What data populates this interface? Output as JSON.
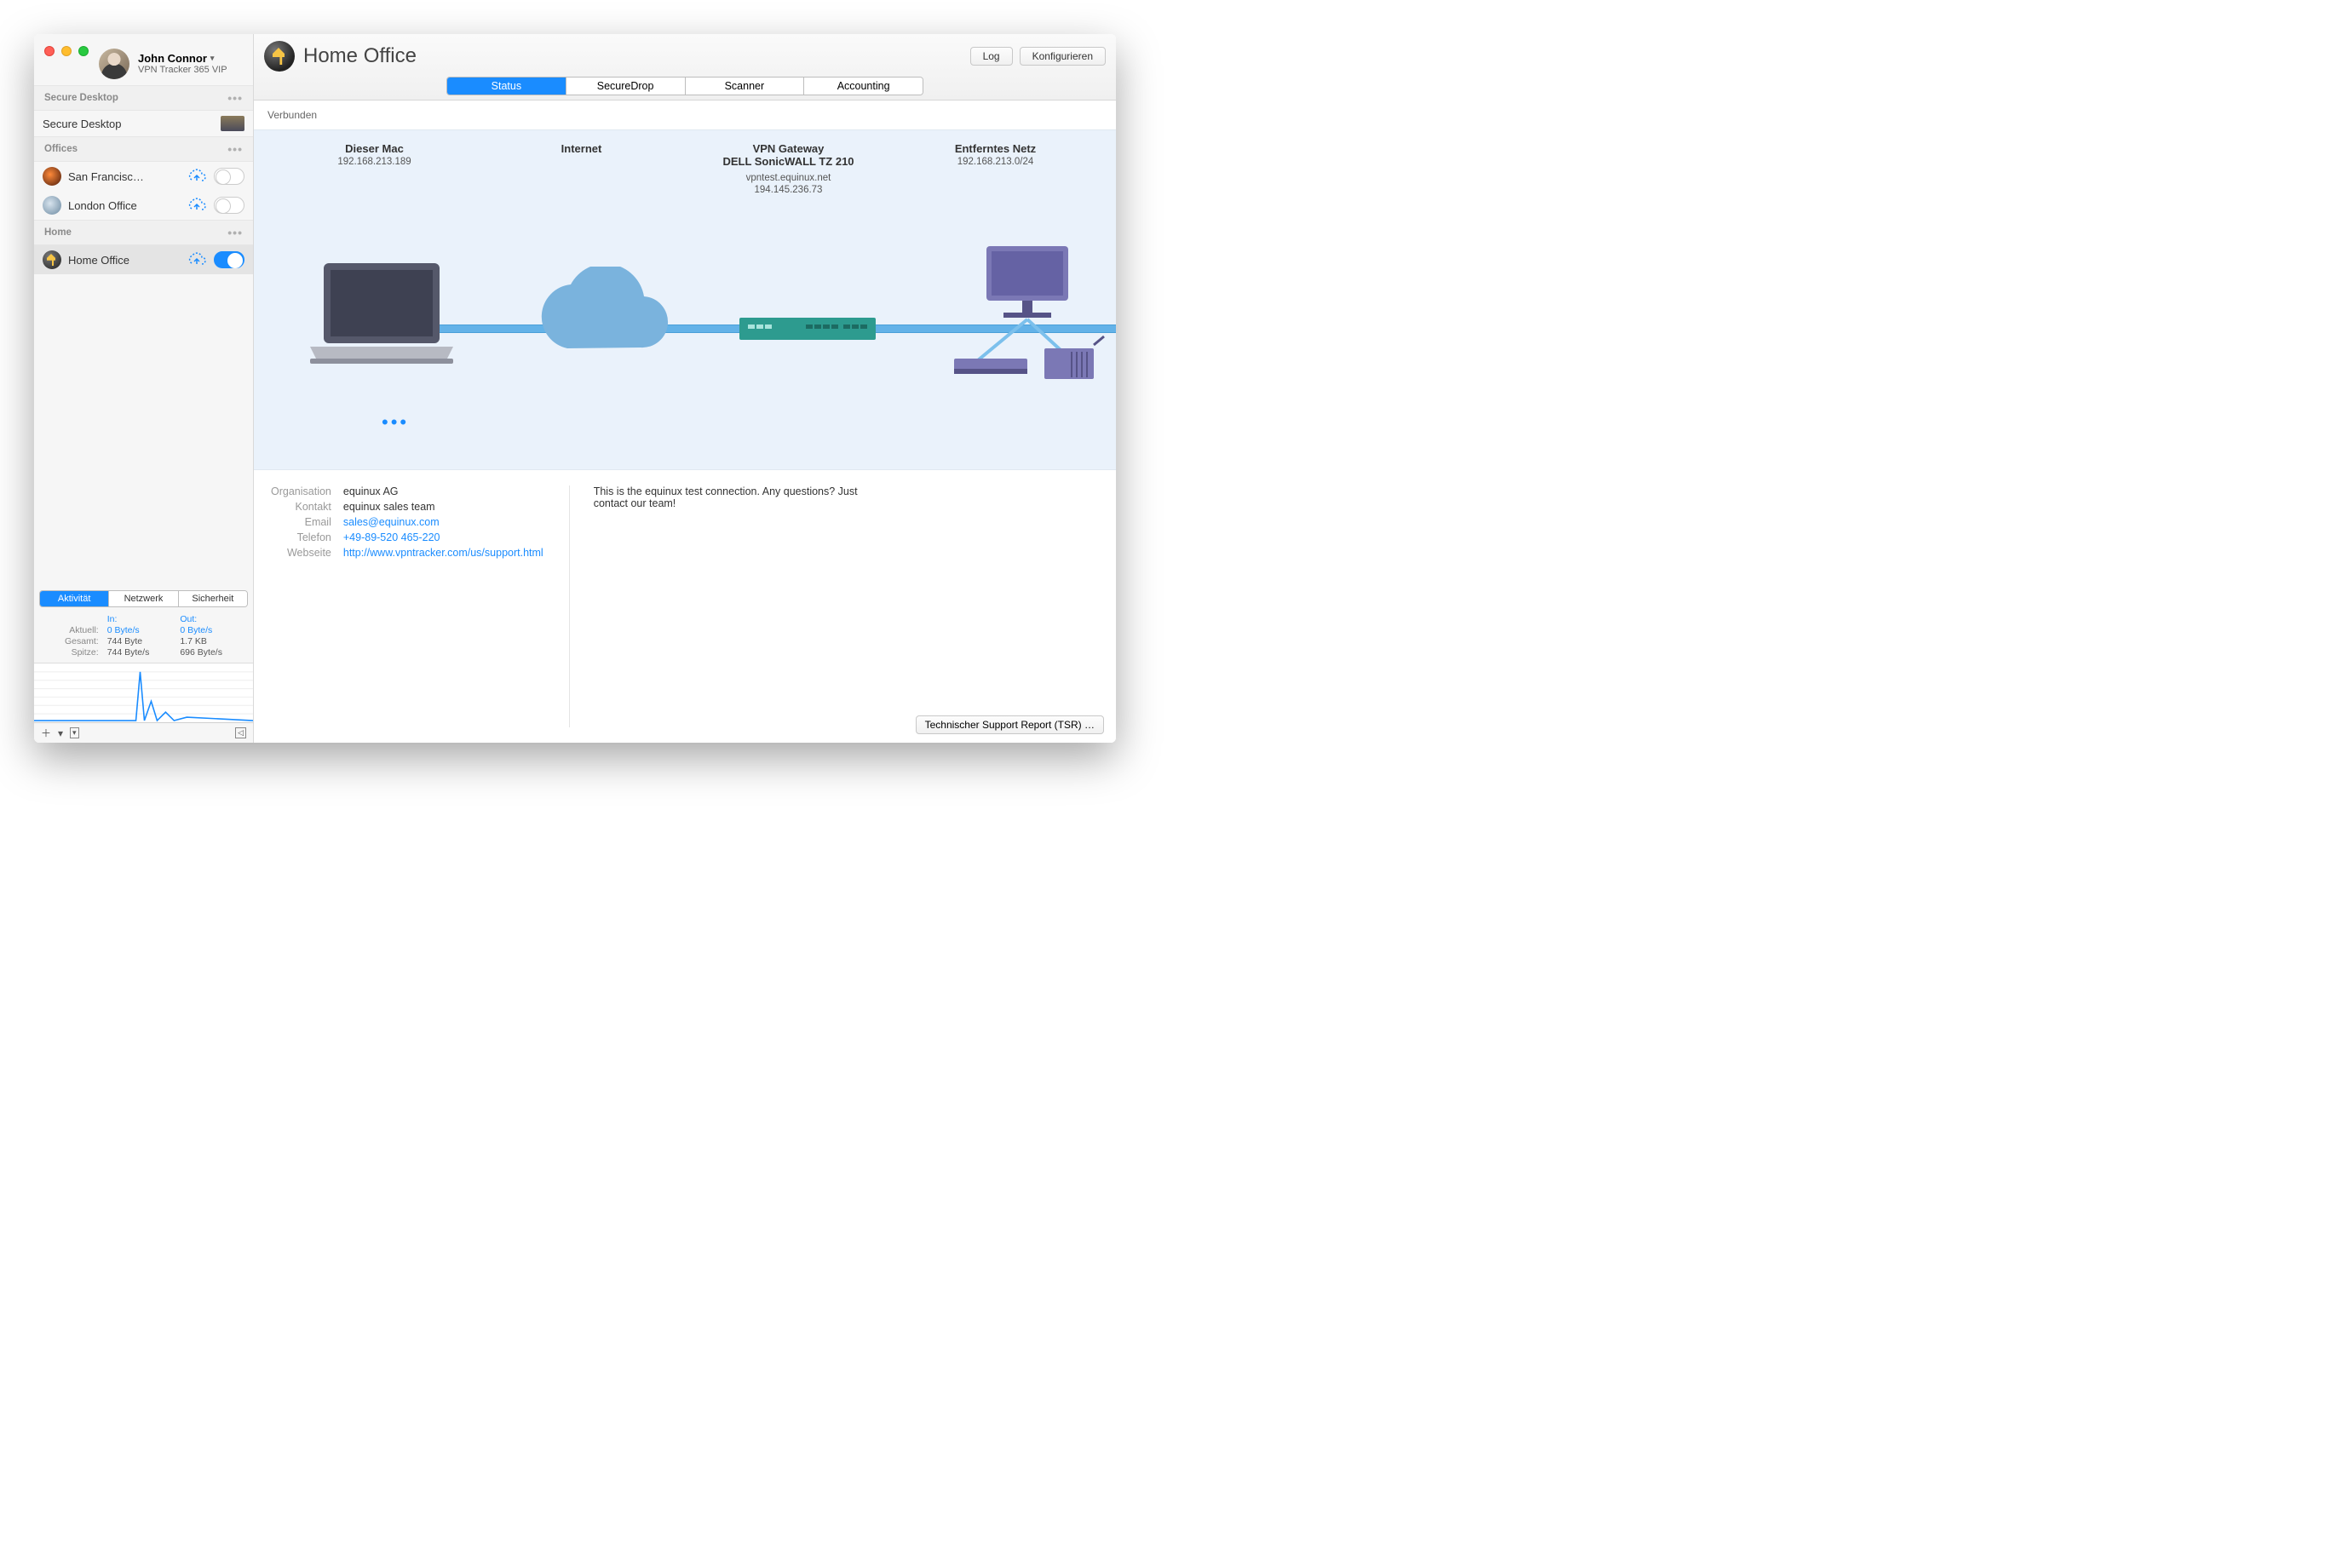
{
  "user": {
    "name": "John Connor",
    "subscription": "VPN Tracker 365 VIP"
  },
  "sidebar": {
    "groups": [
      {
        "title": "Secure Desktop",
        "items": [
          {
            "label": "Secure Desktop"
          }
        ]
      },
      {
        "title": "Offices",
        "items": [
          {
            "label": "San Francisc…"
          },
          {
            "label": "London Office"
          }
        ]
      },
      {
        "title": "Home",
        "items": [
          {
            "label": "Home Office"
          }
        ]
      }
    ]
  },
  "activity": {
    "tabs": [
      "Aktivität",
      "Netzwerk",
      "Sicherheit"
    ],
    "col_in": "In:",
    "col_out": "Out:",
    "rows": {
      "aktuell_label": "Aktuell:",
      "aktuell_in": "0 Byte/s",
      "aktuell_out": "0 Byte/s",
      "gesamt_label": "Gesamt:",
      "gesamt_in": "744 Byte",
      "gesamt_out": "1.7 KB",
      "spitze_label": "Spitze:",
      "spitze_in": "744 Byte/s",
      "spitze_out": "696 Byte/s"
    }
  },
  "header": {
    "title": "Home Office",
    "buttons": {
      "log": "Log",
      "configure": "Konfigurieren"
    },
    "tabs": [
      "Status",
      "SecureDrop",
      "Scanner",
      "Accounting"
    ]
  },
  "status_line": "Verbunden",
  "diagram": {
    "mac": {
      "title": "Dieser Mac",
      "sub1": "192.168.213.189"
    },
    "internet": {
      "title": "Internet"
    },
    "gateway": {
      "title": "VPN Gateway",
      "sub1": "DELL SonicWALL TZ 210",
      "sub2": "vpntest.equinux.net",
      "sub3": "194.145.236.73"
    },
    "remote": {
      "title": "Entferntes Netz",
      "sub1": "192.168.213.0/24"
    }
  },
  "info": {
    "labels": {
      "org": "Organisation",
      "contact": "Kontakt",
      "email": "Email",
      "phone": "Telefon",
      "web": "Webseite"
    },
    "values": {
      "org": "equinux AG",
      "contact": "equinux sales team",
      "email": "sales@equinux.com",
      "phone": "+49-89-520 465-220",
      "web": "http://www.vpntracker.com/us/support.html"
    },
    "note": "This is the equinux test connection. Any questions? Just contact our team!"
  },
  "tsr_button": "Technischer Support Report (TSR) …"
}
